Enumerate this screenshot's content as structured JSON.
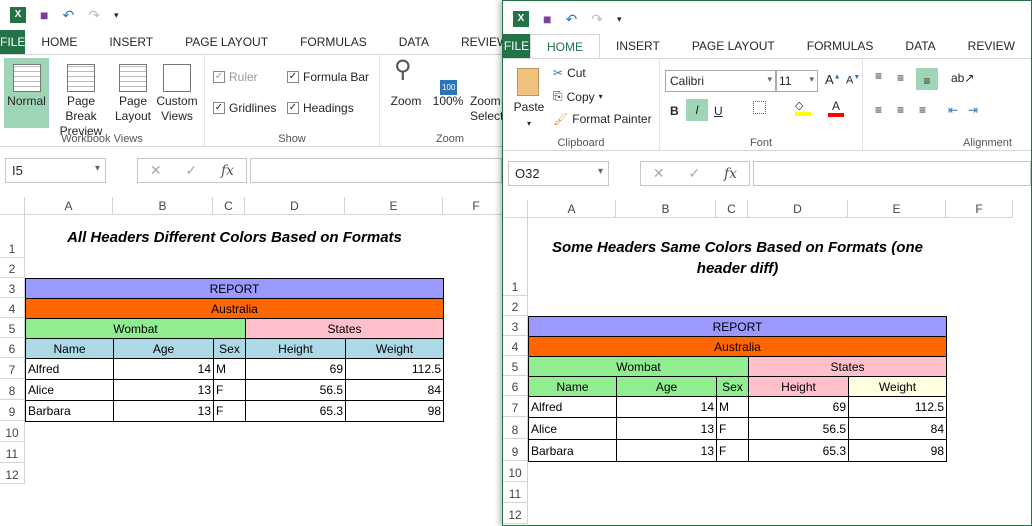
{
  "left": {
    "qat": {
      "undo": "↶",
      "redo": "↷"
    },
    "tabs": [
      "FILE",
      "HOME",
      "INSERT",
      "PAGE LAYOUT",
      "FORMULAS",
      "DATA",
      "REVIEW"
    ],
    "groups": {
      "views": "Workbook Views",
      "show": "Show",
      "zoom": "Zoom"
    },
    "views": [
      "Normal",
      "Page Break Preview",
      "Page Layout",
      "Custom Views"
    ],
    "show": {
      "ruler": "Ruler",
      "formula_bar": "Formula Bar",
      "gridlines": "Gridlines",
      "headings": "Headings"
    },
    "zoom": [
      "Zoom",
      "100%",
      "Zoom to Selection"
    ],
    "zoom_badge": "100",
    "name_box": "I5",
    "fx": "fx",
    "title": "All Headers Different Colors Based on Formats"
  },
  "right": {
    "tabs": [
      "FILE",
      "HOME",
      "INSERT",
      "PAGE LAYOUT",
      "FORMULAS",
      "DATA",
      "REVIEW"
    ],
    "clipboard": {
      "paste": "Paste",
      "cut": "Cut",
      "copy": "Copy",
      "format_painter": "Format Painter",
      "label": "Clipboard"
    },
    "font": {
      "name": "Calibri",
      "size": "11",
      "label": "Font",
      "bold": "B",
      "italic": "I",
      "underline": "U"
    },
    "alignment": {
      "label": "Alignment"
    },
    "name_box": "O32",
    "fx": "fx",
    "title": "Some Headers Same Colors Based on Formats (one header diff)"
  },
  "columns": [
    "A",
    "B",
    "C",
    "D",
    "E",
    "F"
  ],
  "rows": [
    "1",
    "2",
    "3",
    "4",
    "5",
    "6",
    "7",
    "8",
    "9",
    "10",
    "11",
    "12"
  ],
  "report": "REPORT",
  "country": "Australia",
  "group1": "Wombat",
  "group2": "States",
  "headers": [
    "Name",
    "Age",
    "Sex",
    "Height",
    "Weight"
  ],
  "data": [
    [
      "Alfred",
      "14",
      "M",
      "69",
      "112.5"
    ],
    [
      "Alice",
      "13",
      "F",
      "56.5",
      "84"
    ],
    [
      "Barbara",
      "13",
      "F",
      "65.3",
      "98"
    ]
  ],
  "colors": {
    "report": "#9999ff",
    "country": "#ff6600",
    "wombat": "#90ee90",
    "states": "#ffc0cb",
    "left_header_bg": "#add8e6",
    "right_weight_bg": "#ffffe0",
    "accent": "#217346"
  }
}
